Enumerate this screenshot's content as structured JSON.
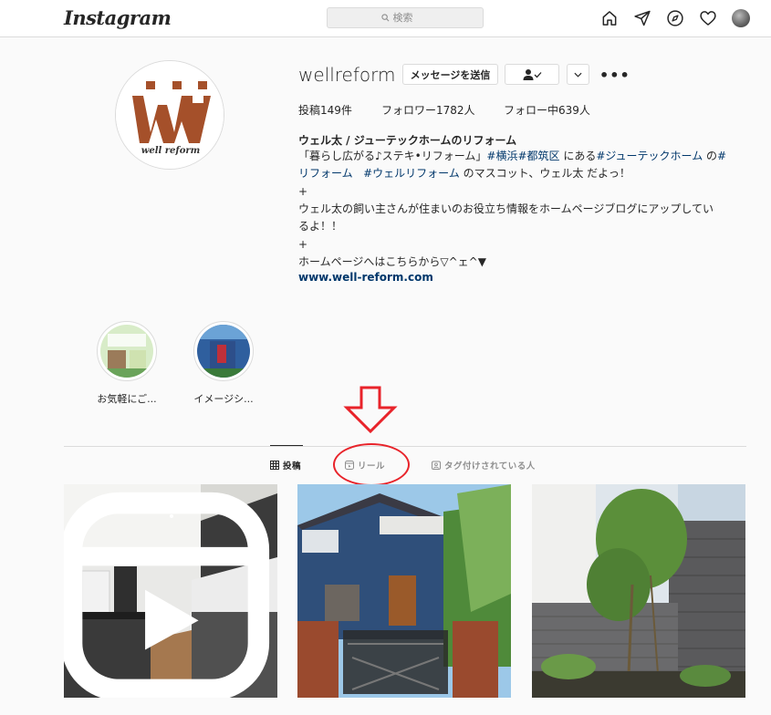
{
  "nav": {
    "logo": "Instagram",
    "search_placeholder": "検索",
    "icons": [
      "home-icon",
      "direct-icon",
      "explore-icon",
      "heart-icon",
      "profile-avatar"
    ]
  },
  "profile": {
    "username": "wellreform",
    "message_button": "メッセージを送信",
    "follow_button_icon": "person-check-icon",
    "more_button_icon": "chevron-down-icon",
    "options_icon": "more-dots-icon",
    "avatar_text": "well reform",
    "stats": {
      "posts": "投稿149件",
      "followers": "フォロワー1782人",
      "following": "フォロー中639人"
    },
    "bio": {
      "name": "ウェル太 / ジューテックホームのリフォーム",
      "line1_pre": "「暮らし広がる♪ステキ•リフォーム」",
      "line1_tag1": "#横浜",
      "line1_tag2": "#都筑区",
      "line1_mid": " にある",
      "line1_tag3": "#ジューテックホーム",
      "line1_post": " の",
      "line1_tag4": "#",
      "line2_tag1": "リフォーム",
      "line2_tag2": "#ウェルリフォーム",
      "line2_post": " のマスコット、ウェル太 だよっ！",
      "line3": "+",
      "line4": "ウェル太の飼い主さんが住まいのお役立ち情報をホームページブログにアップしてい",
      "line5": "るよ！！",
      "line6": "+",
      "line7": "ホームページへはこちらから▽^ェ^▼",
      "link": "www.well-reform.com"
    }
  },
  "highlights": [
    {
      "label": "お気軽にご..."
    },
    {
      "label": "イメージシ..."
    }
  ],
  "tabs": [
    {
      "label": "投稿",
      "icon": "grid-icon",
      "active": true
    },
    {
      "label": "リール",
      "icon": "reels-icon",
      "active": false
    },
    {
      "label": "タグ付けされている人",
      "icon": "tagged-icon",
      "active": false
    }
  ],
  "colors": {
    "annotation_red": "#e8232a",
    "link_blue": "#00376b",
    "logo_brown": "#a5502a"
  }
}
